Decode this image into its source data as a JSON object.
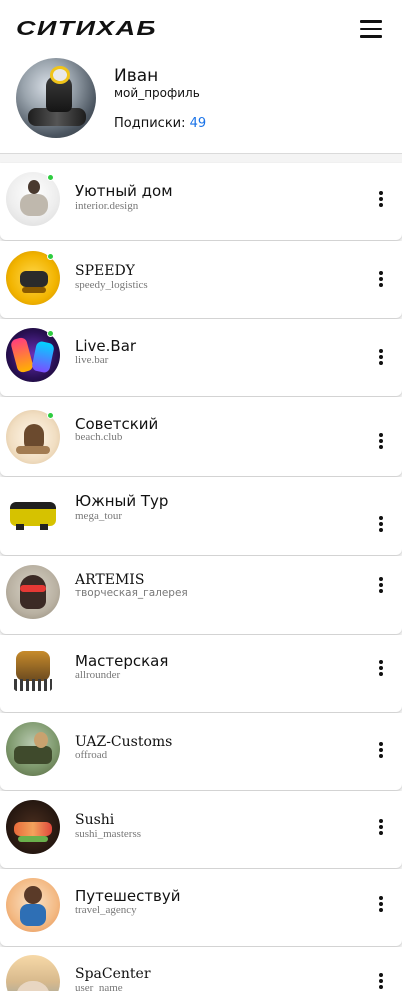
{
  "header": {
    "logo": "СИТИХАБ",
    "menu_icon": "hamburger-icon"
  },
  "profile": {
    "name": "Иван",
    "handle": "мой_профиль",
    "subscriptions_label": "Подписки:",
    "subscriptions_count": "49",
    "count_color": "#1a73e8"
  },
  "list": {
    "items": [
      {
        "title": "Уютный дом",
        "subtitle": "interior.design",
        "online": true,
        "more_icon": "more-vertical-icon"
      },
      {
        "title": "SPEEDY",
        "subtitle": "speedy_logistics",
        "online": true,
        "more_icon": "more-vertical-icon"
      },
      {
        "title": "Live.Bar",
        "subtitle": "live.bar",
        "online": true,
        "more_icon": "more-vertical-icon"
      },
      {
        "title": "Советский",
        "subtitle": "beach.club",
        "online": true,
        "more_icon": "more-vertical-icon"
      },
      {
        "title": "Южный Тур",
        "subtitle": "mega_tour",
        "online": false,
        "more_icon": "more-vertical-icon"
      },
      {
        "title": "ARTEMIS",
        "subtitle": "творческая_галерея",
        "online": false,
        "more_icon": "more-vertical-icon"
      },
      {
        "title": "Мастерская",
        "subtitle": "allrounder",
        "online": false,
        "more_icon": "more-vertical-icon"
      },
      {
        "title": "UAZ-Customs",
        "subtitle": "offroad",
        "online": false,
        "more_icon": "more-vertical-icon"
      },
      {
        "title": "Sushi",
        "subtitle": "sushi_masterss",
        "online": false,
        "more_icon": "more-vertical-icon"
      },
      {
        "title": "Путешествуй",
        "subtitle": "travel_agency",
        "online": false,
        "more_icon": "more-vertical-icon"
      },
      {
        "title": "SpaCenter",
        "subtitle": "user_name",
        "online": false,
        "more_icon": "more-vertical-icon"
      }
    ]
  },
  "colors": {
    "online_dot": "#2ecc40",
    "background": "#f4f4f4",
    "card": "#ffffff"
  }
}
